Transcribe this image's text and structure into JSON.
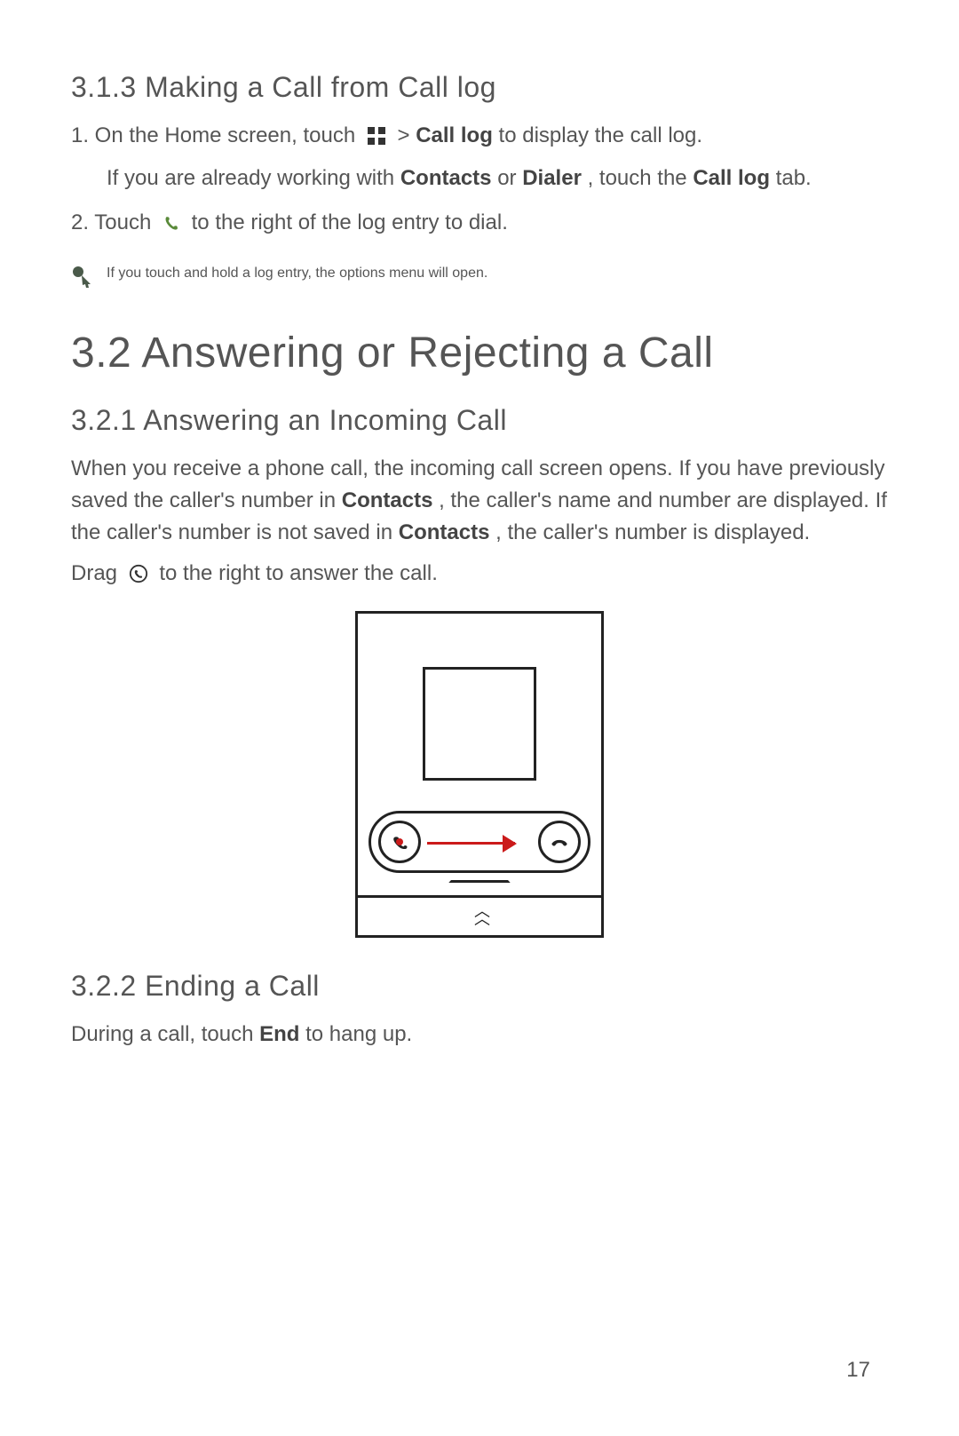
{
  "sec313": {
    "title": "3.1.3  Making a Call from Call log"
  },
  "step1": {
    "prefix": "1. On the Home screen, touch ",
    "after_apps_icon": " > ",
    "bold1": "Call log",
    "after_bold1": " to display the call log."
  },
  "sub1": {
    "a": "If you are already working with ",
    "b1": "Contacts",
    "b": " or ",
    "b2": "Dialer",
    "c": ", touch the ",
    "b3": "Call log",
    "d": " tab."
  },
  "step2": {
    "prefix": "2. Touch ",
    "suffix": " to the right of the log entry to dial."
  },
  "note": {
    "text": "If you touch and hold a log entry, the options menu will open."
  },
  "sec32": {
    "title": "3.2  Answering or Rejecting a Call"
  },
  "sec321": {
    "title": "3.2.1  Answering an Incoming Call"
  },
  "p321": {
    "a": "When you receive a phone call, the incoming call screen opens. If you have previously saved the caller's number in ",
    "b1": "Contacts",
    "b": ", the caller's name and number are displayed. If the caller's number is not saved in ",
    "b2": "Contacts",
    "c": ", the caller's number is displayed."
  },
  "drag": {
    "prefix": "Drag ",
    "suffix": " to the right to answer the call."
  },
  "sec322": {
    "title": "3.2.2  Ending a Call"
  },
  "p322": {
    "a": "During a call, touch ",
    "b1": "End",
    "b": " to hang up."
  },
  "pagenum": "17"
}
